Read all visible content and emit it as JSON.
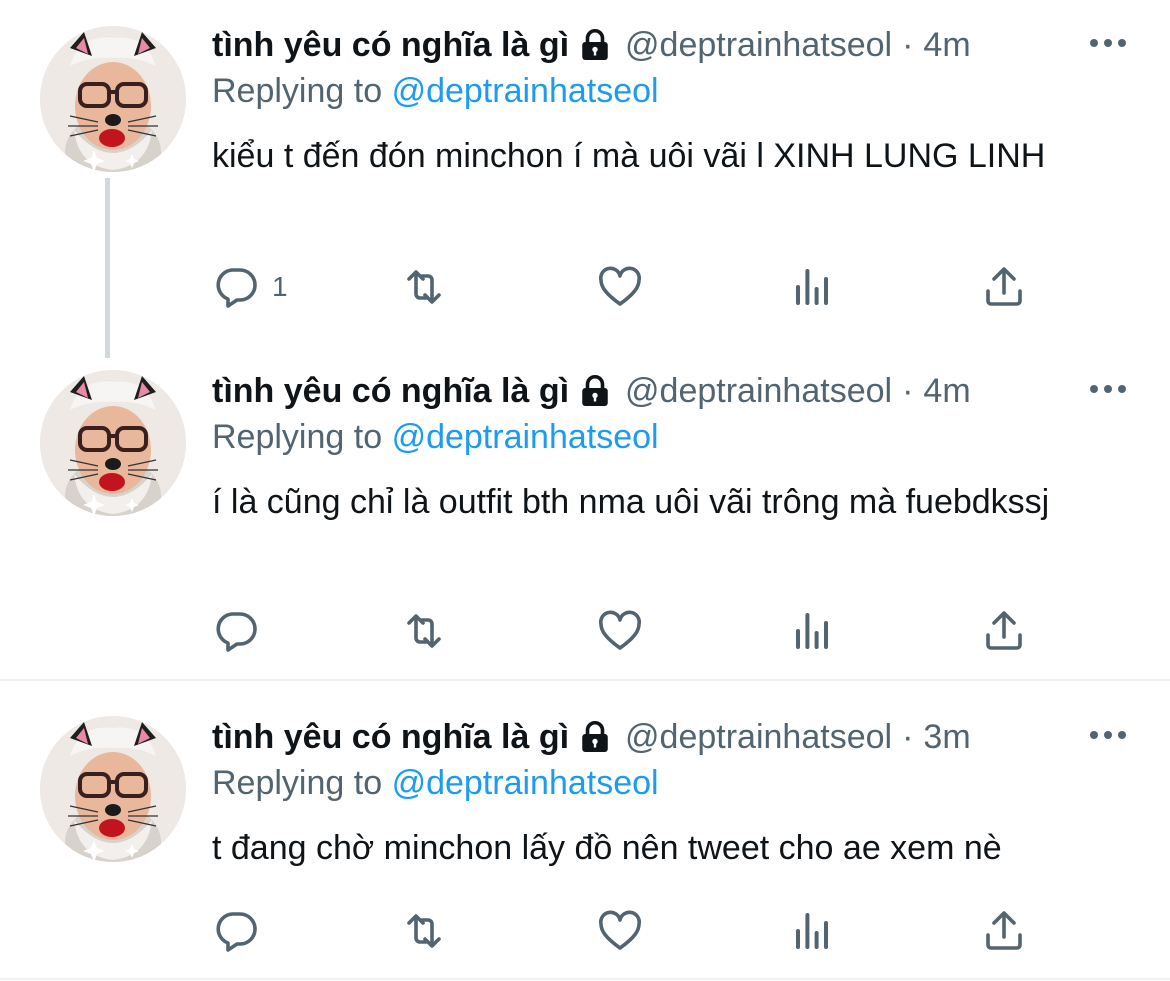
{
  "colors": {
    "text_primary": "#0f1419",
    "text_secondary": "#536471",
    "mention": "#1d9bf0",
    "thread_line": "#cfd9de",
    "divider": "#eff3f4"
  },
  "tweets": [
    {
      "display_name": "tình yêu có nghĩa là gì",
      "lock_icon": "lock-icon",
      "handle": "@deptrainhatseol",
      "separator": "·",
      "time": "4m",
      "replying_prefix": "Replying to",
      "replying_to": "@deptrainhatseol",
      "text": "kiểu t đến đón minchon í mà uôi vãi l XINH LUNG LINH",
      "reply_count": "1"
    },
    {
      "display_name": "tình yêu có nghĩa là gì",
      "lock_icon": "lock-icon",
      "handle": "@deptrainhatseol",
      "separator": "·",
      "time": "4m",
      "replying_prefix": "Replying to",
      "replying_to": "@deptrainhatseol",
      "text": "í là cũng chỉ là outfit bth nma uôi vãi trông mà fuebdkssj",
      "reply_count": ""
    },
    {
      "display_name": "tình yêu có nghĩa là gì",
      "lock_icon": "lock-icon",
      "handle": "@deptrainhatseol",
      "separator": "·",
      "time": "3m",
      "replying_prefix": "Replying to",
      "replying_to": "@deptrainhatseol",
      "text": "t đang chờ minchon lấy đồ nên tweet cho ae xem nè",
      "reply_count": ""
    }
  ],
  "icons": {
    "more": "more-horizontal-icon",
    "reply": "reply-bubble-icon",
    "retweet": "retweet-icon",
    "like": "heart-icon",
    "analytics": "analytics-bars-icon",
    "share": "share-upload-icon"
  }
}
